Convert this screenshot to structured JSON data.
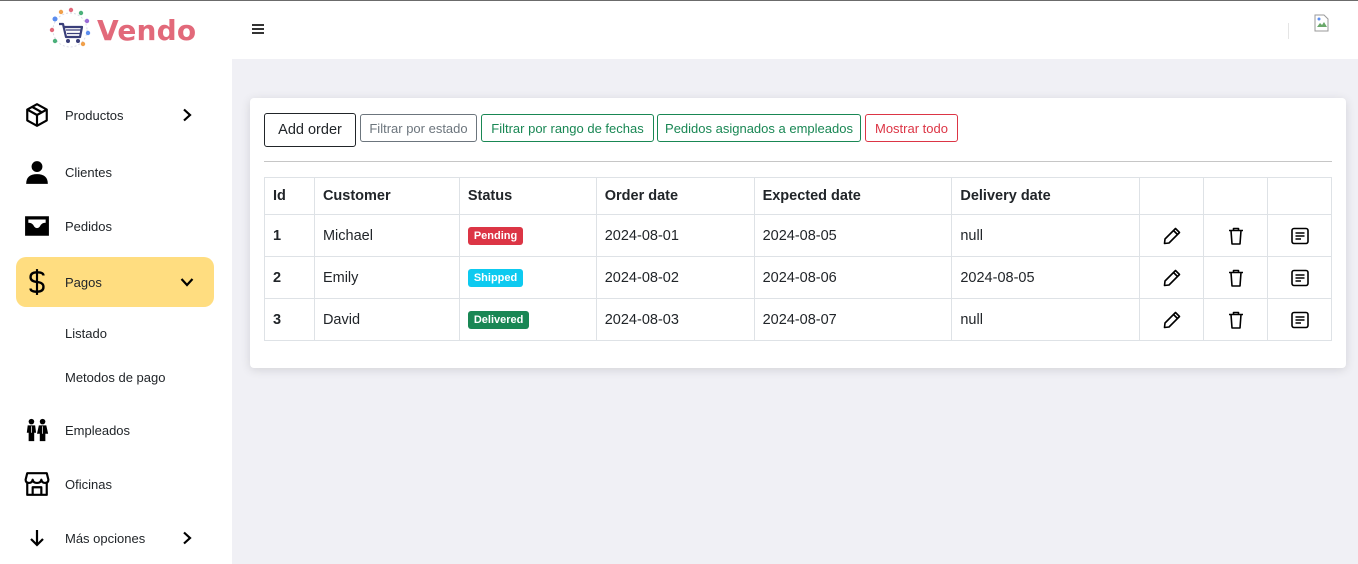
{
  "brand": {
    "name": "Vendo",
    "color": "#e2697a"
  },
  "sidebar": {
    "items": [
      {
        "label": "Productos",
        "icon": "box-icon",
        "chevron": "right"
      },
      {
        "label": "Clientes",
        "icon": "person-icon",
        "chevron": null
      },
      {
        "label": "Pedidos",
        "icon": "inbox-icon",
        "chevron": null
      },
      {
        "label": "Pagos",
        "icon": "dollar-icon",
        "chevron": "down",
        "active": true
      },
      {
        "label": "Empleados",
        "icon": "people-icon",
        "chevron": null
      },
      {
        "label": "Oficinas",
        "icon": "shop-icon",
        "chevron": null
      },
      {
        "label": "Más opciones",
        "icon": "arrow-down-icon",
        "chevron": "right"
      }
    ],
    "subitems": [
      {
        "label": "Listado"
      },
      {
        "label": "Metodos de pago"
      }
    ],
    "active_color": "#ffdd80"
  },
  "toolbar": {
    "add_order": "Add order",
    "filter_status": "Filtrar por estado",
    "filter_dates": "Filtrar por rango de fechas",
    "assigned_employees": "Pedidos asignados a empleados",
    "show_all": "Mostrar todo"
  },
  "table": {
    "headers": [
      "Id",
      "Customer",
      "Status",
      "Order date",
      "Expected date",
      "Delivery date",
      "",
      "",
      ""
    ],
    "rows": [
      {
        "id": "1",
        "customer": "Michael",
        "status": "Pending",
        "status_color": "#dc3545",
        "order_date": "2024-08-01",
        "expected_date": "2024-08-05",
        "delivery_date": "null"
      },
      {
        "id": "2",
        "customer": "Emily",
        "status": "Shipped",
        "status_color": "#0dcaf0",
        "order_date": "2024-08-02",
        "expected_date": "2024-08-06",
        "delivery_date": "2024-08-05"
      },
      {
        "id": "3",
        "customer": "David",
        "status": "Delivered",
        "status_color": "#198754",
        "order_date": "2024-08-03",
        "expected_date": "2024-08-07",
        "delivery_date": "null"
      }
    ],
    "row_actions": [
      "pencil-icon",
      "trash-icon",
      "details-icon"
    ]
  }
}
